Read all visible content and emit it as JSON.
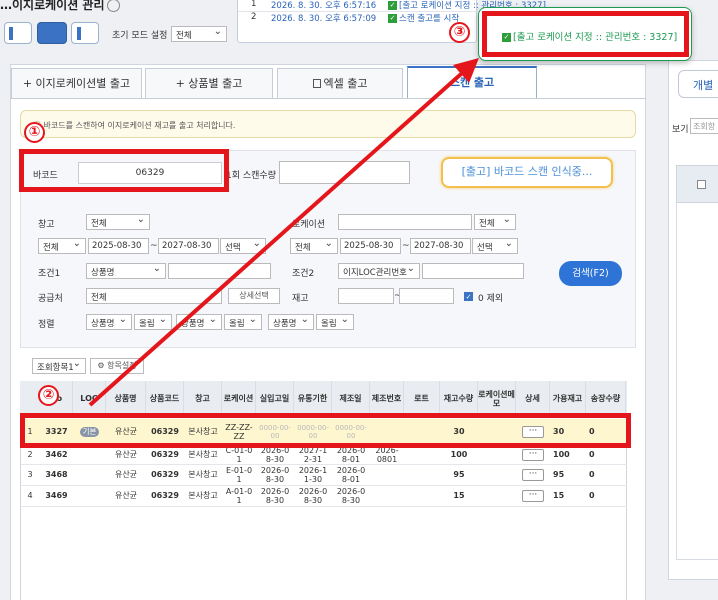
{
  "header": {
    "title": "…이지로케이션 관리",
    "init_mode_label": "초기 모드 설정",
    "init_mode_value": "전체"
  },
  "log": {
    "rows": [
      {
        "no": "1",
        "time": "2026. 8. 30. 오후 6:57:16",
        "msg": "[출고 로케이션 지정 :: 관리번호 : 3327]"
      },
      {
        "no": "2",
        "time": "2026. 8. 30. 오후 6:57:09",
        "msg": "스캔 출고를 시작"
      }
    ]
  },
  "tabs": [
    {
      "label": "+ 이지로케이션별 출고"
    },
    {
      "label": "+ 상품별 출고"
    },
    {
      "label": "엑셀 출고"
    },
    {
      "label": "스캔 출고"
    }
  ],
  "right_panel": {
    "tab_label": "개별",
    "view_label": "보기",
    "view_input": "조회항"
  },
  "info_text": "ⓘ 바코드를 스캔하여 이지로케이션 재고를 출고 처리합니다.",
  "form": {
    "barcode_label": "바코드",
    "barcode_value": "06329",
    "scan_qty_label": "1회 스캔수량",
    "scan_button": "[출고] 바코드 스캔 인식중...",
    "warehouse_label": "창고",
    "warehouse_value": "전체",
    "location_label": "로케이션",
    "location_sel": "전체",
    "date1_type": "전체",
    "date1_from": "2025-08-30",
    "date1_to": "2027-08-30",
    "date1_choice": "선택",
    "date2_type": "전체",
    "date2_from": "2025-08-30",
    "date2_to": "2027-08-30",
    "date2_choice": "선택",
    "cond1_label": "조건1",
    "cond1_value": "상품명",
    "cond2_label": "조건2",
    "cond2_value": "이지LOC관리번호",
    "supplier_label": "공급처",
    "supplier_value": "전체",
    "detail_select_btn": "상세선택",
    "stock_label": "재고",
    "tilde": "~",
    "exclude_zero": "0 제외",
    "sort_label": "정렬",
    "sort": [
      {
        "field": "상품명",
        "order": "올림"
      },
      {
        "field": "상품명",
        "order": "올림"
      },
      {
        "field": "상품명",
        "order": "올림"
      }
    ],
    "search_button": "검색(F2)"
  },
  "table_tools": {
    "view_select": "조회항목1",
    "settings_btn": "⚙ 항목설정"
  },
  "table": {
    "headers": [
      "No",
      "LOC",
      "상품명",
      "상품코드",
      "창고",
      "로케이션",
      "실입고일",
      "유통기한",
      "제조일",
      "제조번호",
      "로트",
      "재고수량",
      "로케이션메모",
      "상세",
      "가용재고",
      "송장수량"
    ],
    "rows": [
      {
        "idx": "1",
        "no": "3327",
        "loc": "기본",
        "name": "유산균",
        "code": "06329",
        "wh": "본사창고",
        "location": "ZZ-ZZ-ZZ",
        "in_date": "0000-00-00",
        "exp": "0000-00-00",
        "mfg": "0000-00-00",
        "mfg_no": "",
        "lot": "",
        "stock": "30",
        "memo": "",
        "detail": "···",
        "avail": "30",
        "inv": "0"
      },
      {
        "idx": "2",
        "no": "3462",
        "loc": "",
        "name": "유산균",
        "code": "06329",
        "wh": "본사창고",
        "location": "C-01-01",
        "in_date": "2026-08-30",
        "exp": "2027-12-31",
        "mfg": "2026-08-01",
        "mfg_no": "2026-0801",
        "lot": "",
        "stock": "100",
        "memo": "",
        "detail": "···",
        "avail": "100",
        "inv": "0"
      },
      {
        "idx": "3",
        "no": "3468",
        "loc": "",
        "name": "유산균",
        "code": "06329",
        "wh": "본사창고",
        "location": "E-01-01",
        "in_date": "2026-08-30",
        "exp": "2026-11-30",
        "mfg": "2026-08-01",
        "mfg_no": "",
        "lot": "",
        "stock": "95",
        "memo": "",
        "detail": "···",
        "avail": "95",
        "inv": "0"
      },
      {
        "idx": "4",
        "no": "3469",
        "loc": "",
        "name": "유산균",
        "code": "06329",
        "wh": "본사창고",
        "location": "A-01-01",
        "in_date": "2026-08-30",
        "exp": "2026-08-30",
        "mfg": "2026-08-30",
        "mfg_no": "",
        "lot": "",
        "stock": "15",
        "memo": "",
        "detail": "···",
        "avail": "15",
        "inv": "0"
      }
    ]
  },
  "annotations": {
    "n1": "①",
    "n2": "②",
    "n3": "③",
    "popup_text": "[출고 로케이션 지정 :: 관리번호 : 3327]",
    "color": "#e4161c"
  }
}
